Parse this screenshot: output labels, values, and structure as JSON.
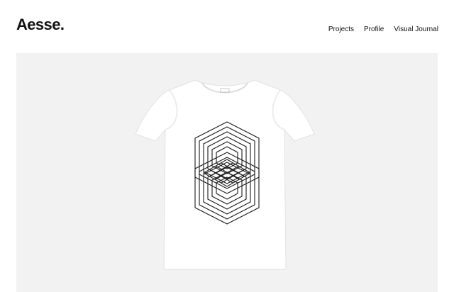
{
  "site": {
    "logo": "Aesse."
  },
  "nav": {
    "items": [
      {
        "label": "Projects"
      },
      {
        "label": "Profile"
      },
      {
        "label": "Visual Journal"
      }
    ]
  },
  "colors": {
    "hero_background": "#f2f2f2",
    "shirt": "#ffffff",
    "print": "#1a1a1a"
  },
  "hero": {
    "image": "white-tshirt-geometric-print"
  }
}
